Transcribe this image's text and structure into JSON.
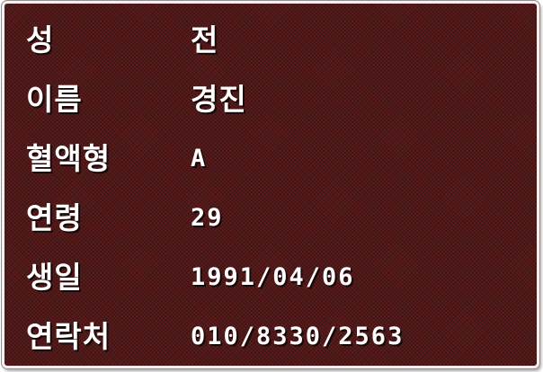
{
  "profile": {
    "rows": [
      {
        "label": "성",
        "value": "전"
      },
      {
        "label": "이름",
        "value": "경진"
      },
      {
        "label": "혈액형",
        "value": "A"
      },
      {
        "label": "연령",
        "value": "29"
      },
      {
        "label": "생일",
        "value": "1991/04/06"
      },
      {
        "label": "연락처",
        "value": "010/8330/2563"
      }
    ]
  },
  "colors": {
    "panel_background": "#5a1c1c",
    "text": "#ffffff",
    "frame_border": "#f4f1f1"
  }
}
